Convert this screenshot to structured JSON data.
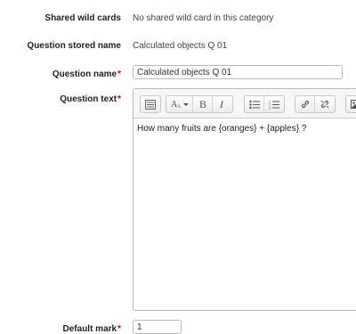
{
  "form": {
    "shared_wild_cards": {
      "label": "Shared wild cards",
      "value": "No shared wild card in this category"
    },
    "question_stored_name": {
      "label": "Question stored name",
      "value": "Calculated objects Q 01"
    },
    "question_name": {
      "label": "Question name",
      "required_marker": "*",
      "value": "Calculated objects Q 01"
    },
    "question_text": {
      "label": "Question text",
      "required_marker": "*",
      "content": "How many fruits are {oranges} + {apples} ?",
      "toolbar": [
        "toggle-toolbar-icon",
        "font-size-icon",
        "bold-icon",
        "italic-icon",
        "unordered-list-icon",
        "ordered-list-icon",
        "link-icon",
        "unlink-icon",
        "image-icon"
      ]
    },
    "default_mark": {
      "label": "Default mark",
      "required_marker": "*",
      "value": "1"
    }
  }
}
